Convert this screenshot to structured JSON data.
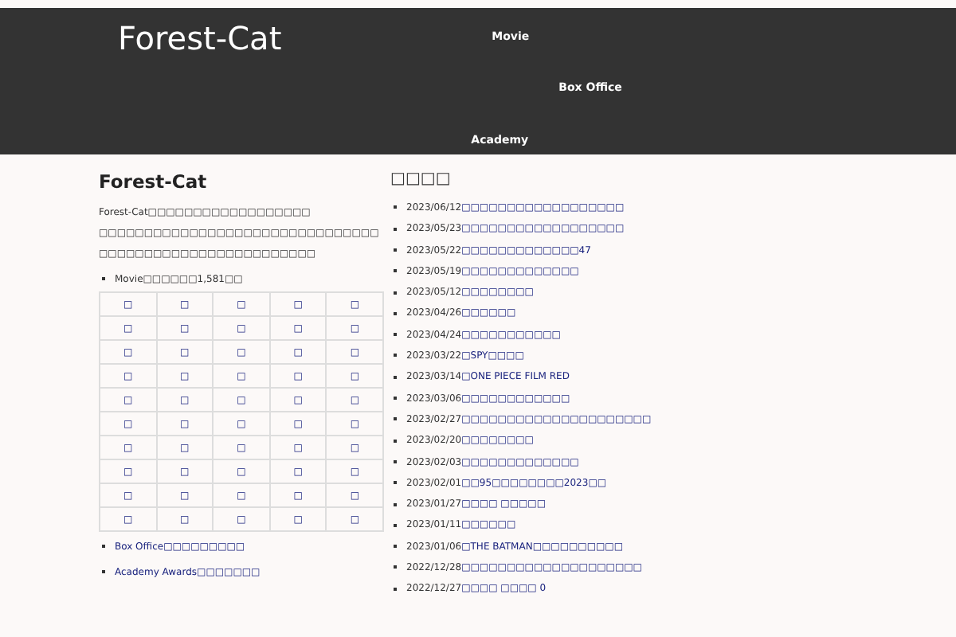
{
  "header": {
    "site_title": "Forest-Cat",
    "nav": [
      "Movie",
      "Box Office",
      "Academy"
    ]
  },
  "main": {
    "title": "Forest-Cat",
    "intro": "Forest-Cat□□□□□□□□□□□□□□□□□□",
    "paragraph": "□□□□□□□□□□□□□□□□□□□□□□□□□□□□□□□□□□□□□□□□□□□□□□□□□□□□□□□",
    "movie_count": "Movie□□□□□□1,581□□",
    "table": [
      [
        "□",
        "□",
        "□",
        "□",
        "□"
      ],
      [
        "□",
        "□",
        "□",
        "□",
        "□"
      ],
      [
        "□",
        "□",
        "□",
        "□",
        "□"
      ],
      [
        "□",
        "□",
        "□",
        "□",
        "□"
      ],
      [
        "□",
        "□",
        "□",
        "□",
        "□"
      ],
      [
        "□",
        "□",
        "□",
        "□",
        "□"
      ],
      [
        "□",
        "□",
        "□",
        "□",
        "□"
      ],
      [
        "□",
        "□",
        "□",
        "□",
        "□"
      ],
      [
        "□",
        "□",
        "□",
        "□",
        "□"
      ],
      [
        "□",
        "□",
        "□",
        "□",
        "□"
      ]
    ],
    "links": [
      "Box Office□□□□□□□□□",
      "Academy Awards□□□□□□□"
    ]
  },
  "sidebar": {
    "heading": "□□□□",
    "posts": [
      {
        "date": "2023/06/12",
        "title": "□□□□□□□□□□□□□□□□□□"
      },
      {
        "date": "2023/05/23",
        "title": "□□□□□□□□□□□□□□□□□□"
      },
      {
        "date": "2023/05/22",
        "title": "□□□□□□□□□□□□□47"
      },
      {
        "date": "2023/05/19",
        "title": "□□□□□□□□□□□□□"
      },
      {
        "date": "2023/05/12",
        "title": "□□□□□□□□"
      },
      {
        "date": "2023/04/26",
        "title": "□□□□□□"
      },
      {
        "date": "2023/04/24",
        "title": "□□□□□□□□□□□"
      },
      {
        "date": "2023/03/22",
        "title": "□SPY□□□□"
      },
      {
        "date": "2023/03/14",
        "title": "□ONE PIECE FILM RED"
      },
      {
        "date": "2023/03/06",
        "title": "□□□□□□□□□□□□"
      },
      {
        "date": "2023/02/27",
        "title": "□□□□□□□□□□□□□□□□□□□□□"
      },
      {
        "date": "2023/02/20",
        "title": "□□□□□□□□"
      },
      {
        "date": "2023/02/03",
        "title": "□□□□□□□□□□□□□"
      },
      {
        "date": "2023/02/01",
        "title": "□□95□□□□□□□□2023□□"
      },
      {
        "date": "2023/01/27",
        "title": "□□□□ □□□□□"
      },
      {
        "date": "2023/01/11",
        "title": "□□□□□□"
      },
      {
        "date": "2023/01/06",
        "title": "□THE BATMAN□□□□□□□□□□"
      },
      {
        "date": "2022/12/28",
        "title": "□□□□□□□□□□□□□□□□□□□□"
      },
      {
        "date": "2022/12/27",
        "title": "□□□□ □□□□ 0"
      }
    ]
  }
}
